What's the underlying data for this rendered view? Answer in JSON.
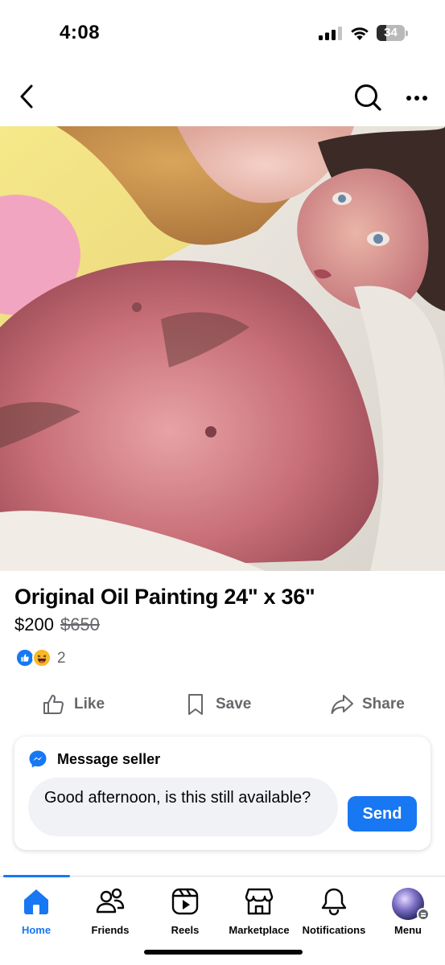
{
  "status_bar": {
    "time": "4:08",
    "battery": "34",
    "battery_level": 0.34
  },
  "nav": {
    "back_icon": "chevron-left-icon",
    "search_icon": "search-icon",
    "more_icon": "more-horizontal-icon"
  },
  "listing": {
    "title": "Original Oil Painting 24\" x 36\"",
    "price": "$200",
    "original_price": "$650",
    "reactions": {
      "types": [
        "like",
        "haha"
      ],
      "count": "2"
    }
  },
  "actions": {
    "like_label": "Like",
    "save_label": "Save",
    "share_label": "Share"
  },
  "message": {
    "header_label": "Message seller",
    "input_value": "Good afternoon, is this still available?",
    "send_label": "Send"
  },
  "tabs": [
    {
      "label": "Home",
      "icon": "home-icon",
      "active": true
    },
    {
      "label": "Friends",
      "icon": "friends-icon",
      "active": false
    },
    {
      "label": "Reels",
      "icon": "reels-icon",
      "active": false
    },
    {
      "label": "Marketplace",
      "icon": "marketplace-icon",
      "active": false
    },
    {
      "label": "Notifications",
      "icon": "bell-icon",
      "active": false
    },
    {
      "label": "Menu",
      "icon": "avatar",
      "active": false
    }
  ],
  "colors": {
    "accent": "#1877f2",
    "text_primary": "#050505",
    "text_secondary": "#65676b"
  }
}
